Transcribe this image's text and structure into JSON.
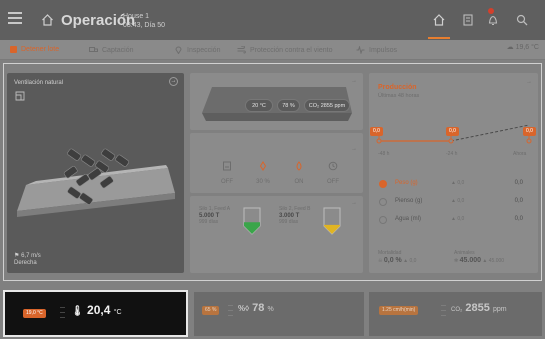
{
  "header": {
    "title": "Operación",
    "house_name": "House 1",
    "date_line": "08:43, Día 50"
  },
  "actions": {
    "stop_batch": "Detener lote",
    "capture": "Captación",
    "inspection": "Inspección",
    "wind_protection": "Protección contra el viento",
    "pulses": "Impulsos",
    "outside_temp": "19,6 °C"
  },
  "ventilation": {
    "label": "Ventilación natural",
    "wind_speed": "6,7 m/s",
    "wind_direction": "Derecha"
  },
  "barn": {
    "temp": "20 °C",
    "humidity": "78 %",
    "co2": "CO₂ 2855 ppm"
  },
  "heating": {
    "items": [
      {
        "label": "OFF"
      },
      {
        "label": "30 %"
      },
      {
        "label": "ON"
      },
      {
        "label": "OFF"
      }
    ]
  },
  "silos": [
    {
      "name": "Silo 1, Feed A",
      "amount": "5.000 T",
      "days": "999 días",
      "level": 0.45,
      "color": "#3aa54a"
    },
    {
      "name": "Silo 2, Feed B",
      "amount": "3.000 T",
      "days": "999 días",
      "level": 0.35,
      "color": "#e0b422"
    }
  ],
  "production": {
    "title": "Producción",
    "subtitle": "Últimas 48 horas",
    "chart_labels": [
      "0,0",
      "0,0",
      "0,0"
    ],
    "axis": [
      "-48 h",
      "-24 h",
      "Ahora"
    ],
    "rows": [
      {
        "name": "Peso (g)",
        "mid": "▲ 0,0",
        "value": "0,0",
        "selected": true
      },
      {
        "name": "Pienso (g)",
        "mid": "▲ 0,0",
        "value": "0,0",
        "selected": false
      },
      {
        "name": "Agua (ml)",
        "mid": "▲ 0,0",
        "value": "0,0",
        "selected": false
      }
    ],
    "mortality_label": "Mortalidad",
    "mortality_value": "0,0 %",
    "mortality_delta": "▲ 0,0",
    "animals_label": "Animales",
    "animals_value": "45.000",
    "animals_delta": "▲ 45.000"
  },
  "sensors": {
    "temperature": {
      "tag": "19,0 °C",
      "value": "20,4",
      "unit": "°C"
    },
    "humidity": {
      "tag": "65 %",
      "value": "78",
      "unit": "%"
    },
    "co2": {
      "tag": "1.25 cm/h(min)",
      "value": "2855",
      "unit": "ppm"
    }
  },
  "colors": {
    "accent": "#d9652b"
  }
}
